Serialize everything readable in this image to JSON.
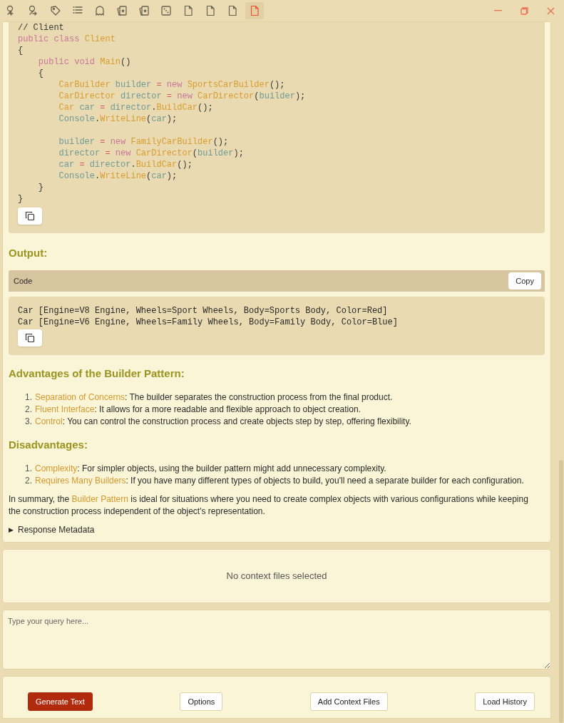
{
  "toolbar": {
    "items": [
      {
        "selected": false
      },
      {
        "selected": false
      },
      {
        "selected": false
      },
      {
        "selected": false
      },
      {
        "selected": false
      },
      {
        "selected": false
      },
      {
        "selected": false
      },
      {
        "selected": false
      },
      {
        "selected": false
      },
      {
        "selected": false
      },
      {
        "selected": false
      },
      {
        "selected": true
      }
    ]
  },
  "message": {
    "code": [
      {
        "kind": "code",
        "tokens": [
          {
            "t": "// Client",
            "kind": "comment"
          }
        ]
      },
      {
        "kind": "code",
        "tokens": [
          {
            "t": "public class ",
            "kind": "kw"
          },
          {
            "t": "Client",
            "kind": "type"
          }
        ]
      },
      {
        "kind": "code",
        "tokens": [
          {
            "t": "{",
            "kind": "punct"
          }
        ]
      },
      {
        "kind": "code",
        "tokens": [
          {
            "t": "    public void ",
            "kind": "kw"
          },
          {
            "t": "Main",
            "kind": "type"
          },
          {
            "t": "()",
            "kind": "punct"
          }
        ]
      },
      {
        "kind": "code",
        "tokens": [
          {
            "t": "    {",
            "kind": "punct"
          }
        ]
      },
      {
        "kind": "code",
        "tokens": [
          {
            "t": "        CarBuilder ",
            "kind": "type"
          },
          {
            "t": "builder ",
            "kind": "ident"
          },
          {
            "t": "= ",
            "kind": "op"
          },
          {
            "t": "new ",
            "kind": "kw"
          },
          {
            "t": "SportsCarBuilder",
            "kind": "type"
          },
          {
            "t": "();",
            "kind": "punct"
          }
        ]
      },
      {
        "kind": "code",
        "tokens": [
          {
            "t": "        CarDirector ",
            "kind": "type"
          },
          {
            "t": "director ",
            "kind": "ident"
          },
          {
            "t": "= ",
            "kind": "op"
          },
          {
            "t": "new ",
            "kind": "kw"
          },
          {
            "t": "CarDirector",
            "kind": "type"
          },
          {
            "t": "(",
            "kind": "punct"
          },
          {
            "t": "builder",
            "kind": "ident"
          },
          {
            "t": ");",
            "kind": "punct"
          }
        ]
      },
      {
        "kind": "code",
        "tokens": [
          {
            "t": "        Car ",
            "kind": "type"
          },
          {
            "t": "car ",
            "kind": "ident"
          },
          {
            "t": "= ",
            "kind": "op"
          },
          {
            "t": "director",
            "kind": "ident"
          },
          {
            "t": ".",
            "kind": "punct"
          },
          {
            "t": "BuildCar",
            "kind": "type"
          },
          {
            "t": "();",
            "kind": "punct"
          }
        ]
      },
      {
        "kind": "code",
        "tokens": [
          {
            "t": "        Console",
            "kind": "ident"
          },
          {
            "t": ".",
            "kind": "punct"
          },
          {
            "t": "WriteLine",
            "kind": "type"
          },
          {
            "t": "(",
            "kind": "punct"
          },
          {
            "t": "car",
            "kind": "ident"
          },
          {
            "t": ");",
            "kind": "punct"
          }
        ]
      },
      {
        "kind": "blank"
      },
      {
        "kind": "code",
        "tokens": [
          {
            "t": "        builder ",
            "kind": "ident"
          },
          {
            "t": "= ",
            "kind": "op"
          },
          {
            "t": "new ",
            "kind": "kw"
          },
          {
            "t": "FamilyCarBuilder",
            "kind": "type"
          },
          {
            "t": "();",
            "kind": "punct"
          }
        ]
      },
      {
        "kind": "code",
        "tokens": [
          {
            "t": "        director ",
            "kind": "ident"
          },
          {
            "t": "= ",
            "kind": "op"
          },
          {
            "t": "new ",
            "kind": "kw"
          },
          {
            "t": "CarDirector",
            "kind": "type"
          },
          {
            "t": "(",
            "kind": "punct"
          },
          {
            "t": "builder",
            "kind": "ident"
          },
          {
            "t": ");",
            "kind": "punct"
          }
        ]
      },
      {
        "kind": "code",
        "tokens": [
          {
            "t": "        car ",
            "kind": "ident"
          },
          {
            "t": "= ",
            "kind": "op"
          },
          {
            "t": "director",
            "kind": "ident"
          },
          {
            "t": ".",
            "kind": "punct"
          },
          {
            "t": "BuildCar",
            "kind": "type"
          },
          {
            "t": "();",
            "kind": "punct"
          }
        ]
      },
      {
        "kind": "code",
        "tokens": [
          {
            "t": "        Console",
            "kind": "ident"
          },
          {
            "t": ".",
            "kind": "punct"
          },
          {
            "t": "WriteLine",
            "kind": "type"
          },
          {
            "t": "(",
            "kind": "punct"
          },
          {
            "t": "car",
            "kind": "ident"
          },
          {
            "t": ");",
            "kind": "punct"
          }
        ]
      },
      {
        "kind": "code",
        "tokens": [
          {
            "t": "    }",
            "kind": "punct"
          }
        ]
      },
      {
        "kind": "code",
        "tokens": [
          {
            "t": "}",
            "kind": "punct"
          }
        ]
      }
    ],
    "output_heading": "Output:",
    "output_block": {
      "label": "Code",
      "copy": "Copy",
      "lines": [
        "Car [Engine=V8 Engine, Wheels=Sport Wheels, Body=Sports Body, Color=Red]",
        "Car [Engine=V6 Engine, Wheels=Family Wheels, Body=Family Body, Color=Blue]"
      ]
    },
    "advantages": {
      "heading": "Advantages of the Builder Pattern:",
      "items": [
        {
          "number": "1.",
          "term": "Separation of Concerns",
          "text": ": The builder separates the construction process from the final product."
        },
        {
          "number": "2.",
          "term": "Fluent Interface",
          "text": ": It allows for a more readable and flexible approach to object creation."
        },
        {
          "number": "3.",
          "term": "Control",
          "text": ": You can control the construction process and create objects step by step, offering flexibility."
        }
      ]
    },
    "disadvantages": {
      "heading": "Disadvantages:",
      "items": [
        {
          "number": "1.",
          "term": "Complexity",
          "text": ": For simpler objects, using the builder pattern might add unnecessary complexity."
        },
        {
          "number": "2.",
          "term": "Requires Many Builders",
          "text": ": If you have many different types of objects to build, you'll need a separate builder for each configuration."
        }
      ]
    },
    "summary": "In summary, the **Builder Pattern** is ideal for situations where you need to create complex objects with various configurations while keeping the construction process independent of the object's representation.",
    "metadata": {
      "marker": "▶",
      "label": "Response Metadata",
      "expanded": false
    }
  },
  "context_files": {
    "text": "No context files selected"
  },
  "query": {
    "placeholder": "Type your query here..."
  },
  "buttons": [
    {
      "label": "Generate Text",
      "kind": "primary"
    },
    {
      "label": "Options",
      "kind": "secondary"
    },
    {
      "label": "Add Context Files",
      "kind": "secondary"
    },
    {
      "label": "Load History",
      "kind": "secondary"
    }
  ]
}
